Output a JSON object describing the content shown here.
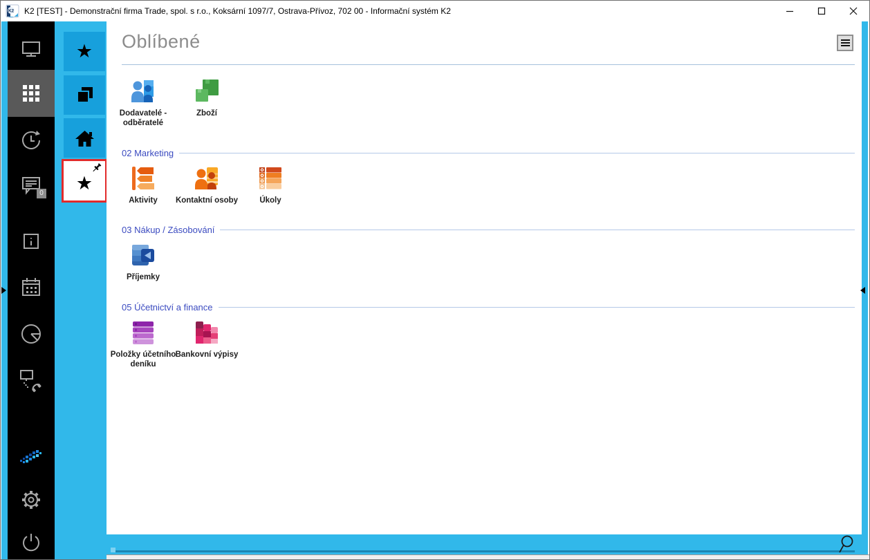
{
  "window": {
    "title": "K2 [TEST] - Demonstrační firma Trade, spol. s r.o., Koksární 1097/7, Ostrava-Přívoz, 702 00 - Informační systém K2",
    "app_name": "K2",
    "controls": {
      "minimize": "Minimalizovat",
      "maximize": "Maximalizovat",
      "close": "Zavřít"
    }
  },
  "colors": {
    "frame_blue": "#31B8EA",
    "button_blue": "#17A0DC",
    "sidebar_black": "#000000",
    "selected_tile_gray": "#595959",
    "selection_red": "#E22B2B",
    "section_header_blue": "#3B4BC0",
    "page_title_gray": "#8C8C8C"
  },
  "left_sidebar": {
    "items": [
      {
        "name": "desktop",
        "icon": "monitor-icon"
      },
      {
        "name": "modules",
        "icon": "apps-grid-icon",
        "selected": true
      },
      {
        "name": "history",
        "icon": "history-clock-icon"
      },
      {
        "name": "messages",
        "icon": "chat-icon",
        "badge": "0"
      },
      {
        "name": "info",
        "icon": "info-icon"
      },
      {
        "name": "calendar",
        "icon": "calendar-icon"
      },
      {
        "name": "reports",
        "icon": "pie-chart-icon"
      },
      {
        "name": "remote-support",
        "icon": "remote-phone-icon"
      },
      {
        "name": "k2-brand",
        "icon": "k2-dots-logo"
      },
      {
        "name": "settings",
        "icon": "gear-icon"
      },
      {
        "name": "power",
        "icon": "power-icon"
      }
    ],
    "messages_badge": "0"
  },
  "quick_sidebar": {
    "items": [
      {
        "name": "favorites",
        "icon": "star-icon"
      },
      {
        "name": "open-windows",
        "icon": "pages-icon"
      },
      {
        "name": "home",
        "icon": "home-icon"
      },
      {
        "name": "favorites-pinned",
        "icon": "star-icon",
        "pinned": true,
        "selected": true
      }
    ],
    "star_glyph": "★"
  },
  "main": {
    "title": "Oblíbené",
    "sections": [
      {
        "label": "",
        "tiles": [
          {
            "label": "Dodavatelé - odběratelé",
            "icon": "suppliers-customers-icon"
          },
          {
            "label": "Zboží",
            "icon": "goods-boxes-icon"
          }
        ]
      },
      {
        "label": "02 Marketing",
        "tiles": [
          {
            "label": "Aktivity",
            "icon": "activities-tags-icon"
          },
          {
            "label": "Kontaktní osoby",
            "icon": "contact-persons-icon"
          },
          {
            "label": "Úkoly",
            "icon": "tasks-list-icon"
          }
        ]
      },
      {
        "label": "03 Nákup / Zásobování",
        "tiles": [
          {
            "label": "Příjemky",
            "icon": "receipts-icon"
          }
        ]
      },
      {
        "label": "05 Účetnictví a finance",
        "tiles": [
          {
            "label": "Položky účetního deníku",
            "icon": "journal-items-icon"
          },
          {
            "label": "Bankovní výpisy",
            "icon": "bank-statements-icon"
          }
        ]
      }
    ]
  },
  "bottom_bar": {
    "icon": "search-icon"
  }
}
